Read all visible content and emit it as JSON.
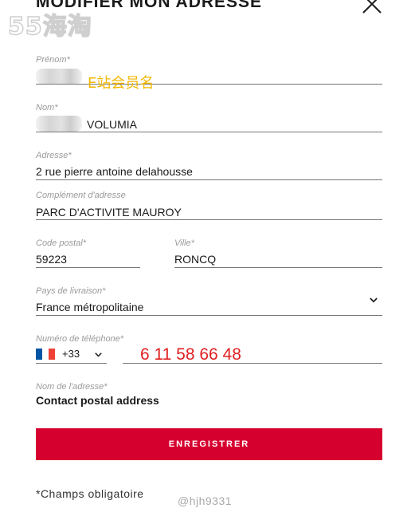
{
  "watermark_top": "55海淘",
  "modal": {
    "title": "MODIFIER MON ADRESSE",
    "close_icon": "close-icon"
  },
  "form": {
    "prenom": {
      "label": "Prénom*",
      "annotation": "E站会员名"
    },
    "nom": {
      "label": "Nom*",
      "value": "VOLUMIA"
    },
    "adresse": {
      "label": "Adresse*",
      "value": "2 rue pierre antoine delahousse"
    },
    "complement": {
      "label": "Complément d'adresse",
      "value": "PARC D'ACTIVITE MAUROY"
    },
    "code_postal": {
      "label": "Code postal*",
      "value": "59223"
    },
    "ville": {
      "label": "Ville*",
      "value": "RONCQ"
    },
    "pays": {
      "label": "Pays de livraison*",
      "value": "France métropolitaine",
      "icon": "chevron-down-icon"
    },
    "telephone": {
      "label": "Numéro de téléphone*",
      "country_code": "+33",
      "number": "6 11 58 66 48",
      "flag": "france-flag-icon"
    },
    "nom_adresse": {
      "label": "Nom de l'adresse*",
      "value": "Contact postal address"
    }
  },
  "save_button": {
    "label": "ENREGISTRER"
  },
  "required_note": "*Champs obligatoire",
  "watermark_bottom": "@hjh9331",
  "colors": {
    "accent": "#d6002f",
    "annotation_yellow": "#f2b700",
    "annotation_red": "#e02020",
    "flag_blue": "#0055a4",
    "flag_red": "#ef4135"
  }
}
